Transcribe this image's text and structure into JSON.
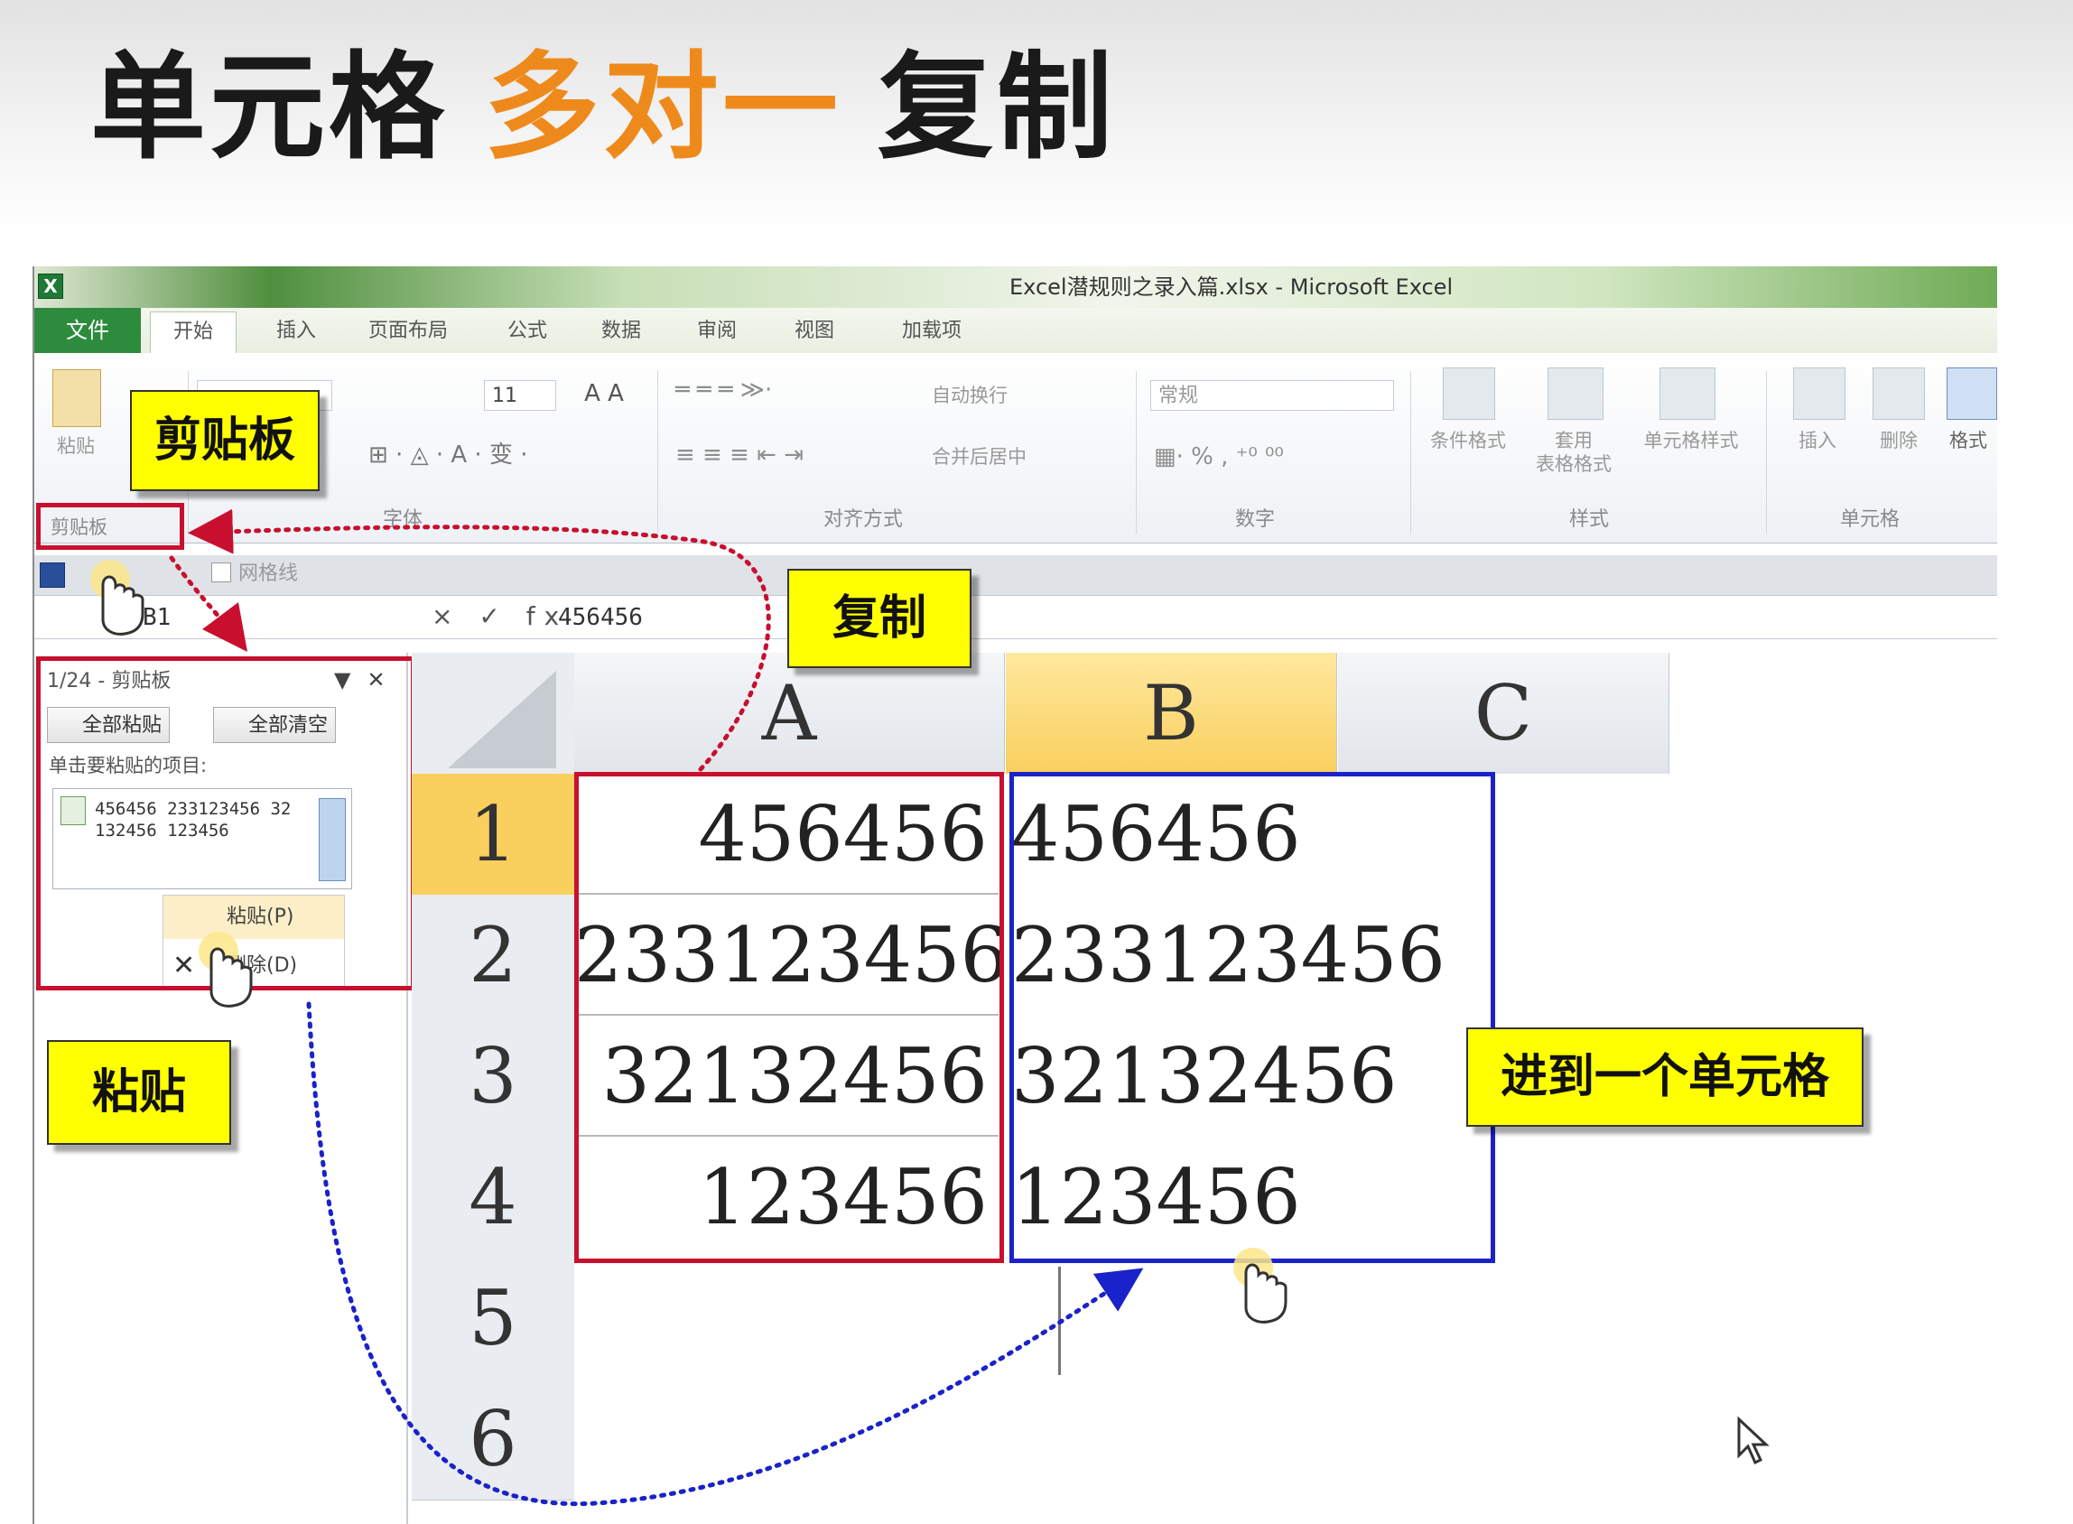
{
  "slide": {
    "title_part1": "单元格",
    "title_part2": "多对一",
    "title_part3": "复制"
  },
  "window": {
    "title": "Excel潜规则之录入篇.xlsx - Microsoft Excel",
    "app_icon": "X"
  },
  "ribbon": {
    "tabs": [
      "文件",
      "开始",
      "插入",
      "页面布局",
      "公式",
      "数据",
      "审阅",
      "视图",
      "加载项"
    ],
    "paste_label": "粘贴",
    "font_size": "11",
    "wrap_text": "自动换行",
    "merge_center": "合并后居中",
    "number_format": "常规",
    "conditional_format": "条件格式",
    "table_format": "套用\n表格格式",
    "cell_styles": "单元格样式",
    "insert": "插入",
    "delete": "删除",
    "format": "格式",
    "groups": {
      "clipboard": "剪贴板",
      "font": "字体",
      "alignment": "对齐方式",
      "number": "数字",
      "styles": "样式",
      "cells": "单元格"
    }
  },
  "qat": {
    "gridlines": "网格线"
  },
  "formula_bar": {
    "name_box": "B1",
    "fx_icons": "× ✓ fx",
    "value": "456456"
  },
  "clipboard_pane": {
    "title": "1/24 - 剪贴板",
    "paste_all": "全部粘贴",
    "clear_all": "全部清空",
    "hint": "单击要粘贴的项目:",
    "item_text": "456456 233123456 32132456 123456",
    "menu_paste": "粘贴(P)",
    "menu_delete": "删除(D)"
  },
  "sheet": {
    "columns": [
      "A",
      "B",
      "C"
    ],
    "selected_column": "B",
    "rows": [
      "1",
      "2",
      "3",
      "4",
      "5",
      "6"
    ],
    "selected_row": "1",
    "colA": [
      "456456",
      "233123456",
      "32132456",
      "123456"
    ],
    "colB": [
      "456456",
      "233123456",
      "32132456",
      "123456"
    ]
  },
  "callouts": {
    "clipboard": "剪贴板",
    "copy": "复制",
    "paste": "粘贴",
    "into_one_cell": "进到一个单元格"
  },
  "colors": {
    "title_accent": "#ee8a1c",
    "callout_bg": "#ffff00",
    "red_box": "#c8102e",
    "blue_box": "#1a22c9",
    "selected_header": "#f9cf5d"
  },
  "icons": [
    "hand-pointer-icon",
    "mouse-arrow-icon",
    "clipboard-icon",
    "save-icon"
  ]
}
